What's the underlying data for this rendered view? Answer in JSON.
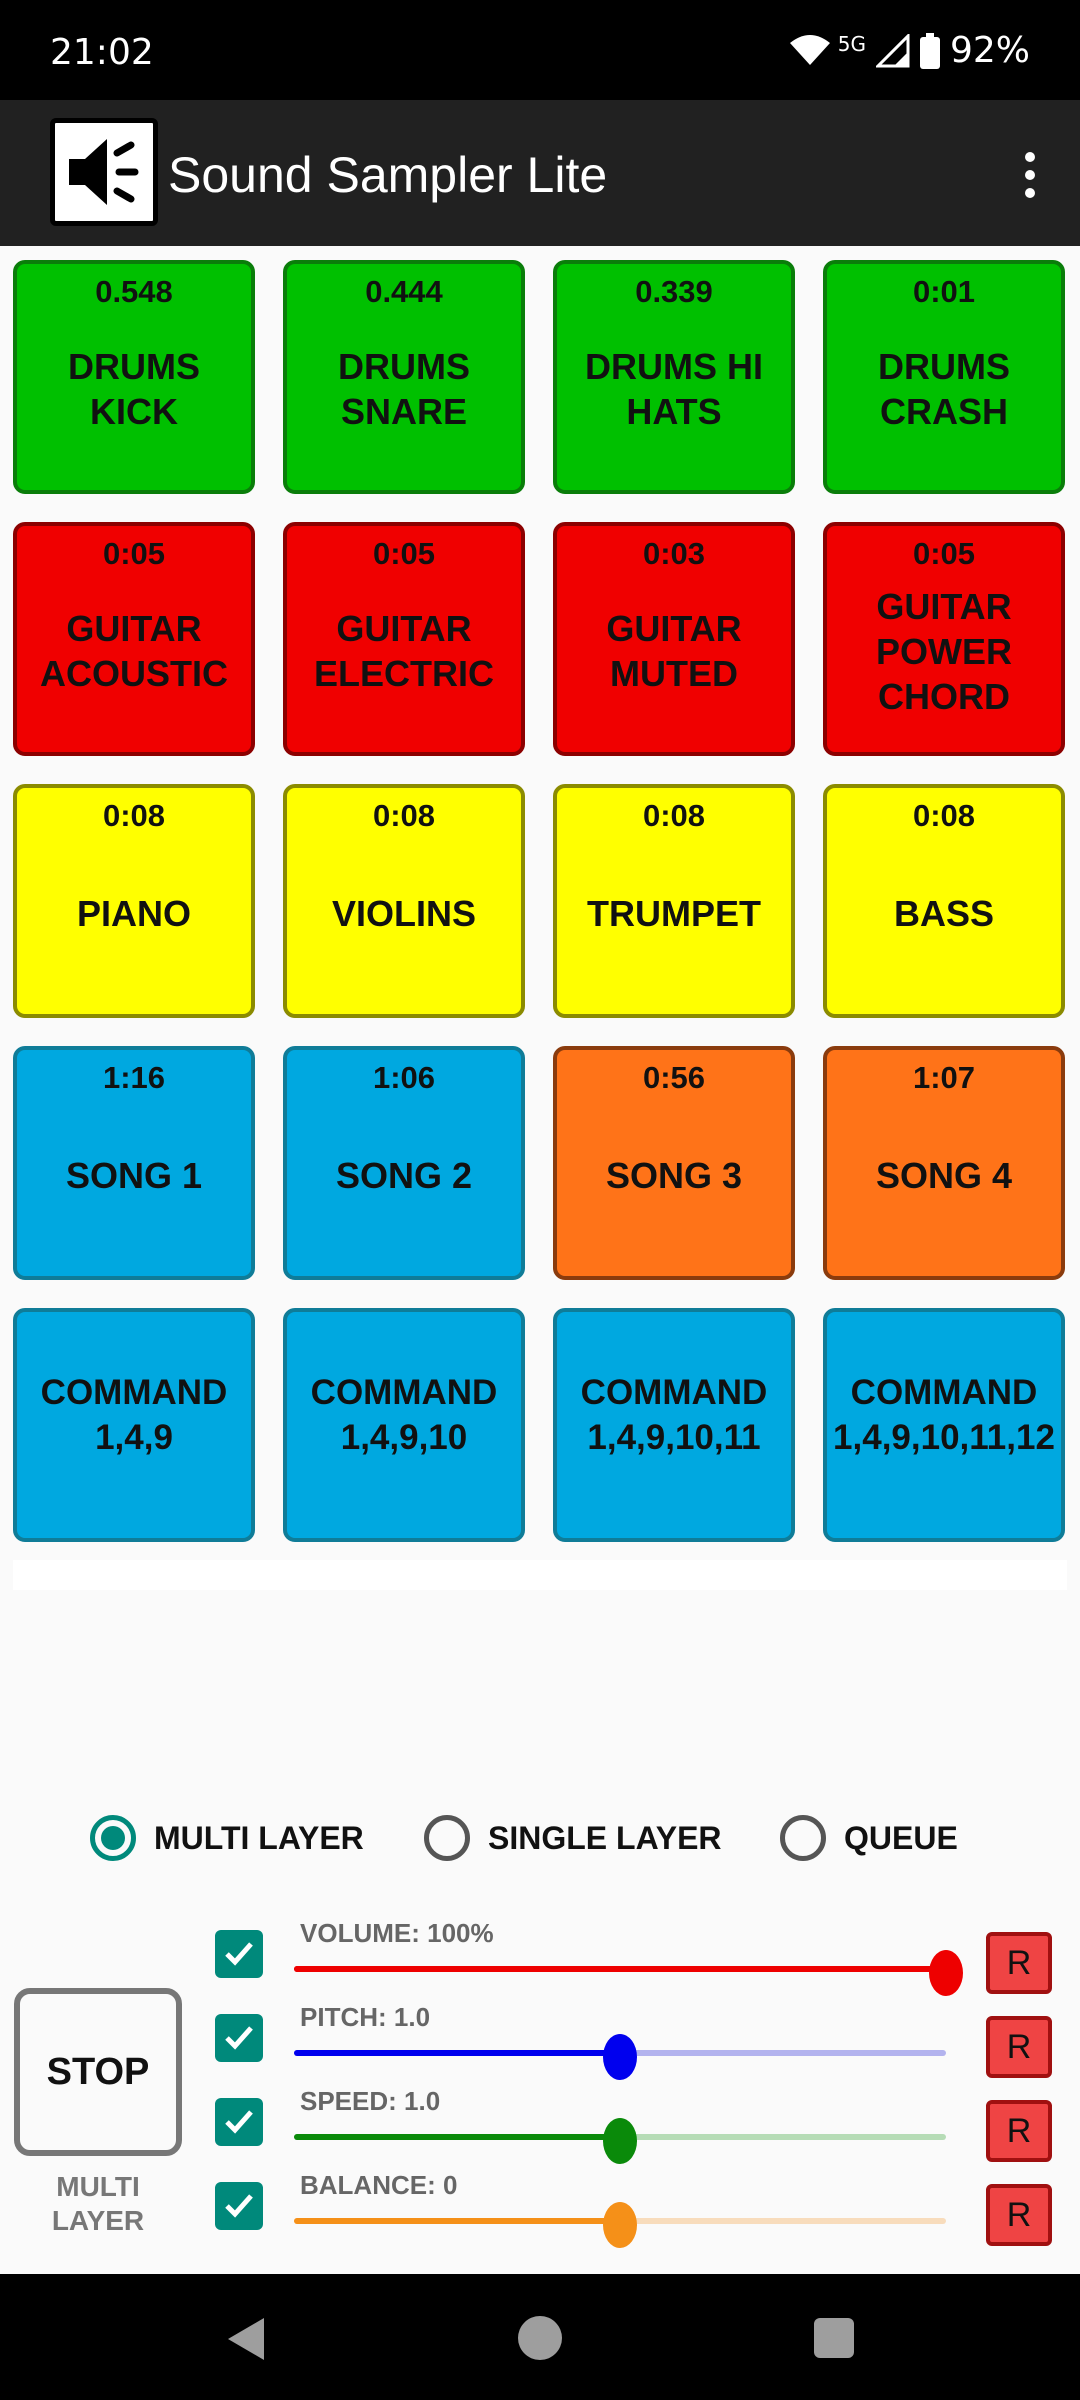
{
  "status_bar": {
    "time": "21:02",
    "network": "5G",
    "battery": "92%"
  },
  "app_bar": {
    "title": "Sound Sampler Lite",
    "icon": "speaker-icon",
    "menu_icon": "more-vert-icon"
  },
  "pads": [
    {
      "time": "0.548",
      "label": "DRUMS KICK",
      "color": "green"
    },
    {
      "time": "0.444",
      "label": "DRUMS\nSNARE",
      "color": "green"
    },
    {
      "time": "0.339",
      "label": "DRUMS HI\nHATS",
      "color": "green"
    },
    {
      "time": "0:01",
      "label": "DRUMS\nCRASH",
      "color": "green"
    },
    {
      "time": "0:05",
      "label": "GUITAR\nACOUSTIC",
      "color": "red"
    },
    {
      "time": "0:05",
      "label": "GUITAR\nELECTRIC",
      "color": "red"
    },
    {
      "time": "0:03",
      "label": "GUITAR\nMUTED",
      "color": "red"
    },
    {
      "time": "0:05",
      "label": "GUITAR\nPOWER\nCHORD",
      "color": "red"
    },
    {
      "time": "0:08",
      "label": "PIANO",
      "color": "yellow"
    },
    {
      "time": "0:08",
      "label": "VIOLINS",
      "color": "yellow"
    },
    {
      "time": "0:08",
      "label": "TRUMPET",
      "color": "yellow"
    },
    {
      "time": "0:08",
      "label": "BASS",
      "color": "yellow"
    },
    {
      "time": "1:16",
      "label": "SONG 1",
      "color": "blue"
    },
    {
      "time": "1:06",
      "label": "SONG 2",
      "color": "blue"
    },
    {
      "time": "0:56",
      "label": "SONG 3",
      "color": "orange"
    },
    {
      "time": "1:07",
      "label": "SONG 4",
      "color": "orange"
    },
    {
      "time": "",
      "label": "COMMAND\n1,4,9",
      "color": "blue"
    },
    {
      "time": "",
      "label": "COMMAND\n1,4,9,10",
      "color": "blue"
    },
    {
      "time": "",
      "label": "COMMAND\n1,4,9,10,11",
      "color": "blue"
    },
    {
      "time": "",
      "label": "COMMAND\n1,4,9,10,11,12",
      "color": "blue"
    }
  ],
  "modes": [
    {
      "label": "MULTI LAYER",
      "checked": true
    },
    {
      "label": "SINGLE LAYER",
      "checked": false
    },
    {
      "label": "QUEUE",
      "checked": false
    }
  ],
  "stop": {
    "label": "STOP",
    "caption": "MULTI\nLAYER"
  },
  "controls": [
    {
      "label": "VOLUME: 100%",
      "checked": true,
      "value_fraction": 1.0,
      "color": "#ee0000",
      "track_color": "#ee0000",
      "reset": "R"
    },
    {
      "label": "PITCH: 1.0",
      "checked": true,
      "value_fraction": 0.5,
      "color": "#0000ee",
      "track_color": "#b3b3ee",
      "reset": "R"
    },
    {
      "label": "SPEED: 1.0",
      "checked": true,
      "value_fraction": 0.5,
      "color": "#0a8a0a",
      "track_color": "#b6dcb6",
      "reset": "R"
    },
    {
      "label": "BALANCE: 0",
      "checked": true,
      "value_fraction": 0.5,
      "color": "#f59018",
      "track_color": "#f8dcbc",
      "reset": "R"
    }
  ],
  "nav": {
    "back_icon": "back-icon",
    "home_icon": "home-icon",
    "recents_icon": "recents-icon"
  }
}
